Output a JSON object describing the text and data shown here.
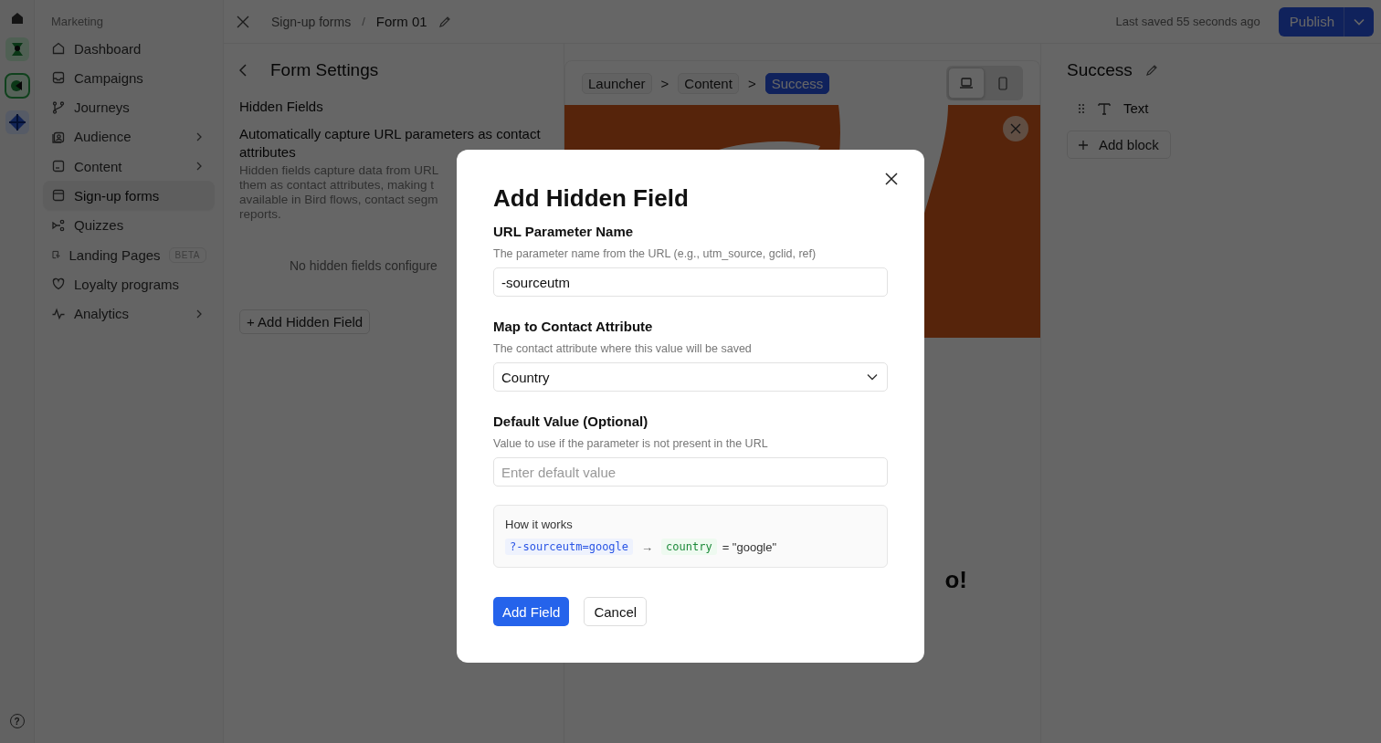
{
  "sidebar": {
    "section": "Marketing",
    "items": [
      {
        "label": "Dashboard",
        "selected": false,
        "has_submenu": false
      },
      {
        "label": "Campaigns",
        "selected": false,
        "has_submenu": false
      },
      {
        "label": "Journeys",
        "selected": false,
        "has_submenu": false
      },
      {
        "label": "Audience",
        "selected": false,
        "has_submenu": true
      },
      {
        "label": "Content",
        "selected": false,
        "has_submenu": true
      },
      {
        "label": "Sign-up forms",
        "selected": true,
        "has_submenu": false
      },
      {
        "label": "Quizzes",
        "selected": false,
        "has_submenu": false
      },
      {
        "label": "Landing Pages",
        "selected": false,
        "has_submenu": false,
        "badge": "BETA"
      },
      {
        "label": "Loyalty programs",
        "selected": false,
        "has_submenu": false
      },
      {
        "label": "Analytics",
        "selected": false,
        "has_submenu": true
      }
    ]
  },
  "help_glyph": "?",
  "topbar": {
    "breadcrumbs": [
      "Sign-up forms",
      "Form 01"
    ],
    "breadcrumb_separator": "/",
    "saved_status": "Last saved 55 seconds ago",
    "publish_label": "Publish"
  },
  "form_settings": {
    "title": "Form Settings",
    "section": "Hidden Fields",
    "description": "Automatically capture URL parameters as contact attributes",
    "help_lines": [
      "Hidden fields capture data from URL",
      "them as contact attributes, making t",
      "available in Bird flows, contact segm",
      "reports."
    ],
    "empty_state": "No hidden fields configure",
    "add_button": "+ Add Hidden Field"
  },
  "preview": {
    "steps": [
      {
        "label": "Launcher",
        "selected": false
      },
      {
        "label": "Content",
        "selected": false
      },
      {
        "label": "Success",
        "selected": true
      }
    ],
    "step_separator": ">",
    "devices": [
      {
        "kind": "desktop",
        "selected": true
      },
      {
        "kind": "mobile",
        "selected": false
      }
    ],
    "heading_fragment": "o!"
  },
  "block_panel": {
    "title": "Success",
    "blocks": [
      {
        "label": "Text"
      }
    ],
    "add_label": "Add block"
  },
  "modal": {
    "title": "Add Hidden Field",
    "fields": [
      {
        "kind": "text",
        "label": "URL Parameter Name",
        "help": "The parameter name from the URL (e.g., utm_source, gclid, ref)",
        "value": "-sourceutm"
      },
      {
        "kind": "select",
        "label": "Map to Contact Attribute",
        "help": "The contact attribute where this value will be saved",
        "value": "Country"
      },
      {
        "kind": "text",
        "label": "Default Value (Optional)",
        "help": "Value to use if the parameter is not present in the URL",
        "placeholder": "Enter default value"
      }
    ],
    "example": {
      "title": "How it works",
      "param": "?-sourceutm=google",
      "arrow": "→",
      "attribute": "country",
      "result": "= \"google\""
    },
    "buttons": [
      {
        "label": "Add Field",
        "kind": "primary"
      },
      {
        "label": "Cancel",
        "kind": "secondary"
      }
    ]
  }
}
